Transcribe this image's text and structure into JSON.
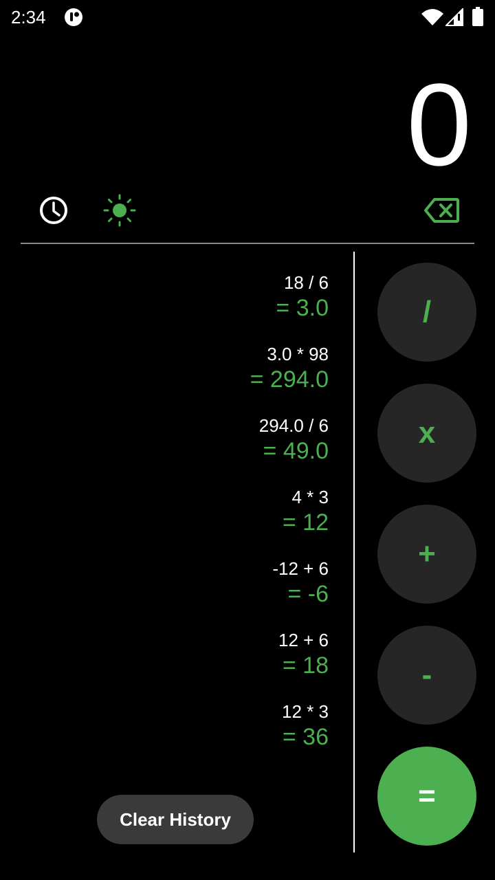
{
  "status_bar": {
    "time": "2:34",
    "icons": [
      "app-notification-icon",
      "wifi-icon",
      "cell-signal-icon",
      "battery-icon"
    ]
  },
  "display": {
    "value": "0"
  },
  "toolbar": {
    "icons": [
      "history-clock-icon",
      "theme-sun-icon",
      "backspace-icon"
    ]
  },
  "history": [
    {
      "expression": "18 / 6",
      "result": "= 3.0"
    },
    {
      "expression": "3.0 * 98",
      "result": "= 294.0"
    },
    {
      "expression": "294.0 / 6",
      "result": "= 49.0"
    },
    {
      "expression": "4 * 3",
      "result": "= 12"
    },
    {
      "expression": "-12 + 6",
      "result": "= -6"
    },
    {
      "expression": "12 + 6",
      "result": "= 18"
    },
    {
      "expression": "12 * 3",
      "result": "= 36"
    }
  ],
  "clear_history_label": "Clear History",
  "operators": {
    "divide": "/",
    "multiply": "x",
    "add": "+",
    "subtract": "-",
    "equals": "="
  },
  "colors": {
    "accent": "#4caf50",
    "background": "#000000",
    "button": "#262626",
    "clear_button": "#3a3a3a"
  }
}
